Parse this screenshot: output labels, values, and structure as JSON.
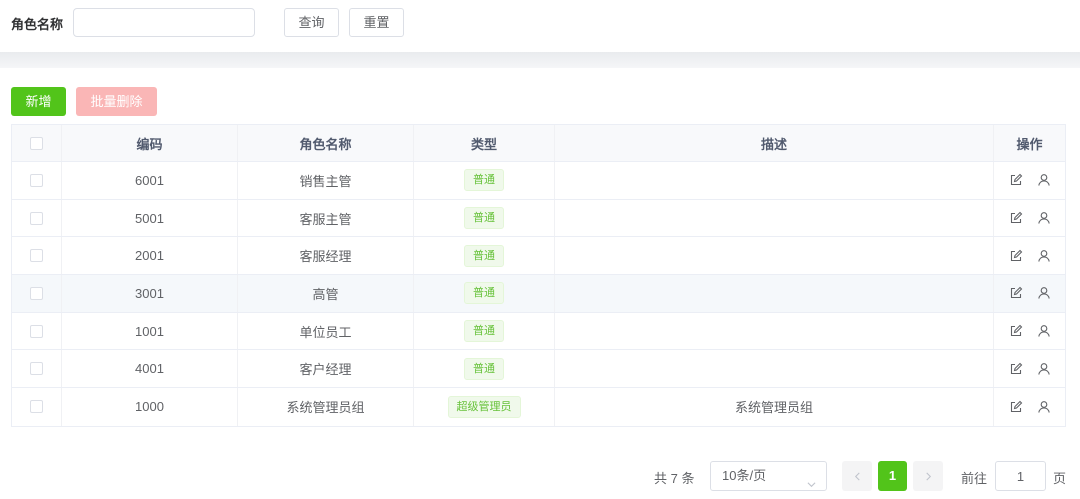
{
  "search": {
    "label": "角色名称",
    "value": "",
    "placeholder": "",
    "query_label": "查询",
    "reset_label": "重置"
  },
  "actions": {
    "add_label": "新增",
    "batch_delete_label": "批量删除"
  },
  "colors": {
    "primary": "#52c41a",
    "danger_disabled": "#fab6b6",
    "tag_green": "#67c23a"
  },
  "table": {
    "headers": {
      "code": "编码",
      "name": "角色名称",
      "type": "类型",
      "description": "描述",
      "operation": "操作"
    },
    "rows": [
      {
        "code": "6001",
        "name": "销售主管",
        "type": "普通",
        "description": ""
      },
      {
        "code": "5001",
        "name": "客服主管",
        "type": "普通",
        "description": ""
      },
      {
        "code": "2001",
        "name": "客服经理",
        "type": "普通",
        "description": ""
      },
      {
        "code": "3001",
        "name": "高管",
        "type": "普通",
        "description": ""
      },
      {
        "code": "1001",
        "name": "单位员工",
        "type": "普通",
        "description": ""
      },
      {
        "code": "4001",
        "name": "客户经理",
        "type": "普通",
        "description": ""
      },
      {
        "code": "1000",
        "name": "系统管理员组",
        "type": "超级管理员",
        "description": "系统管理员组"
      }
    ],
    "row_icons": [
      "edit-icon",
      "user-icon"
    ]
  },
  "pagination": {
    "total_text": "共 7 条",
    "page_size": "10条/页",
    "current_page": "1",
    "goto_label": "前往",
    "goto_value": "1",
    "page_suffix": "页"
  }
}
